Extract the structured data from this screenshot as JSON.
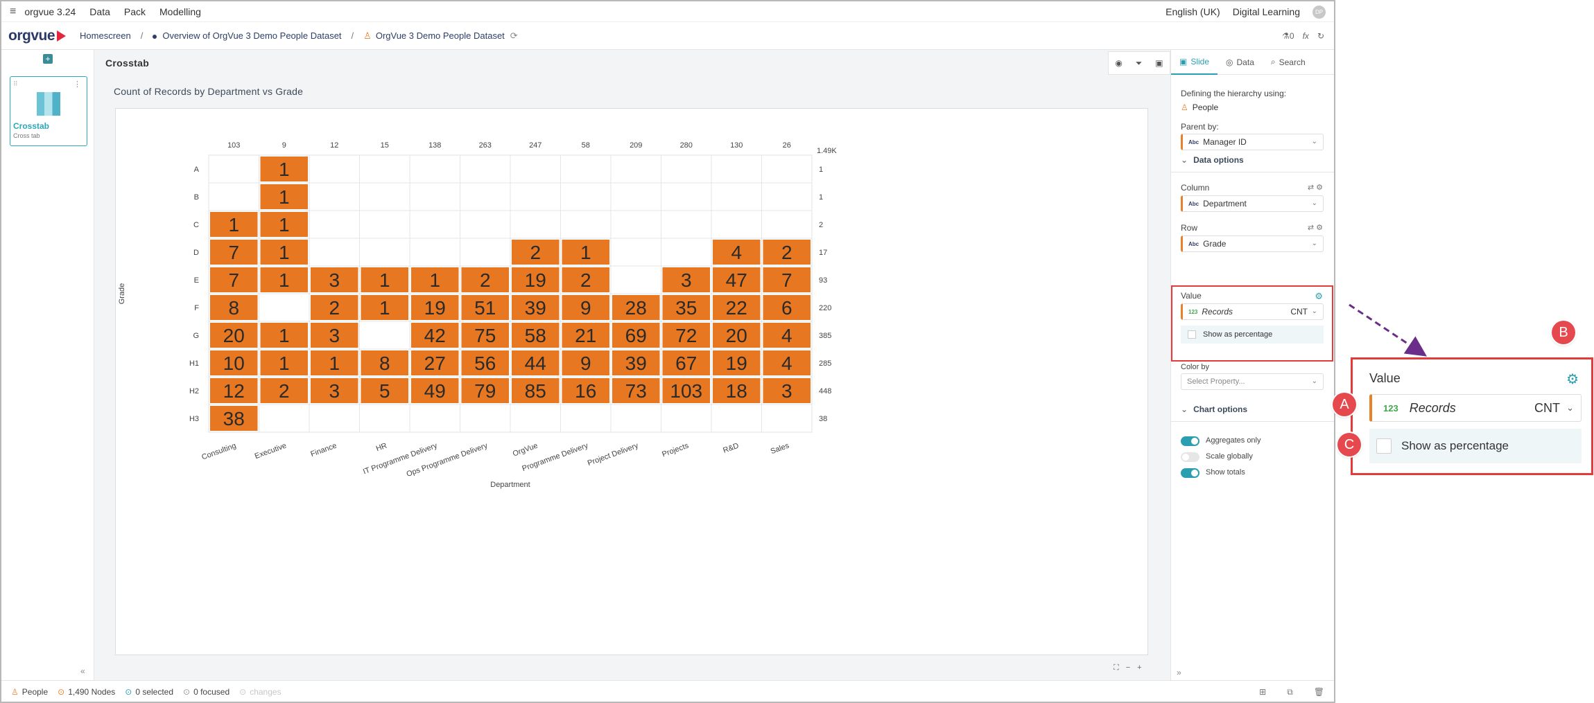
{
  "topbar": {
    "app_version": "orgvue 3.24",
    "menus": [
      "Data",
      "Pack",
      "Modelling"
    ],
    "language": "English (UK)",
    "workspace": "Digital Learning",
    "avatar_initials": "DP"
  },
  "header": {
    "logo": "orgvue",
    "breadcrumbs": [
      "Homescreen",
      "Overview of OrgVue 3 Demo People Dataset",
      "OrgVue 3 Demo People Dataset"
    ],
    "counter": "0"
  },
  "slides": {
    "thumb_title": "Crosstab",
    "thumb_subtitle": "Cross tab"
  },
  "main": {
    "slide_title": "Crosstab",
    "chart_title": "Count of Records by Department vs Grade"
  },
  "chart_data": {
    "type": "heatmap",
    "title": "Count of Records by Department vs Grade",
    "xlabel": "Department",
    "ylabel": "Grade",
    "columns": [
      "Consulting",
      "Executive",
      "Finance",
      "HR",
      "IT Programme Delivery",
      "Ops Programme Delivery",
      "OrgVue",
      "Programme Delivery",
      "Project Delivery",
      "Projects",
      "R&D",
      "Sales"
    ],
    "column_totals": [
      "103",
      "9",
      "12",
      "15",
      "138",
      "263",
      "247",
      "58",
      "209",
      "280",
      "130",
      "26"
    ],
    "rows": [
      "A",
      "B",
      "C",
      "D",
      "E",
      "F",
      "G",
      "H1",
      "H2",
      "H3"
    ],
    "row_totals": [
      "1",
      "1",
      "2",
      "17",
      "93",
      "220",
      "385",
      "285",
      "448",
      "38"
    ],
    "grand_total": "1.49K",
    "values": [
      [
        null,
        1,
        null,
        null,
        null,
        null,
        null,
        null,
        null,
        null,
        null,
        null
      ],
      [
        null,
        1,
        null,
        null,
        null,
        null,
        null,
        null,
        null,
        null,
        null,
        null
      ],
      [
        1,
        1,
        null,
        null,
        null,
        null,
        null,
        null,
        null,
        null,
        null,
        null
      ],
      [
        7,
        1,
        null,
        null,
        null,
        null,
        2,
        1,
        null,
        null,
        4,
        2
      ],
      [
        7,
        1,
        3,
        1,
        1,
        2,
        19,
        2,
        null,
        3,
        47,
        7
      ],
      [
        8,
        null,
        2,
        1,
        19,
        51,
        39,
        9,
        28,
        35,
        22,
        6
      ],
      [
        20,
        1,
        3,
        null,
        42,
        75,
        58,
        21,
        69,
        72,
        20,
        4
      ],
      [
        10,
        1,
        1,
        8,
        27,
        56,
        44,
        9,
        39,
        67,
        19,
        4
      ],
      [
        12,
        2,
        3,
        5,
        49,
        79,
        85,
        16,
        73,
        103,
        18,
        3
      ],
      [
        38,
        null,
        null,
        null,
        null,
        null,
        null,
        null,
        null,
        null,
        null,
        null
      ]
    ],
    "cell_color": "#e87722"
  },
  "panel": {
    "tabs": [
      "Slide",
      "Data",
      "Search"
    ],
    "hierarchy_label": "Defining the hierarchy using:",
    "hierarchy_value": "People",
    "parent_label": "Parent by:",
    "parent_value": "Manager ID",
    "data_options": "Data options",
    "column_label": "Column",
    "column_value": "Department",
    "row_label": "Row",
    "row_value": "Grade",
    "value_label": "Value",
    "value_prop": "Records",
    "value_agg": "CNT",
    "show_pct": "Show as percentage",
    "colorby_label": "Color by",
    "colorby_placeholder": "Select Property...",
    "chart_options": "Chart options",
    "toggles": [
      {
        "label": "Aggregates only",
        "on": true
      },
      {
        "label": "Scale globally",
        "on": false
      },
      {
        "label": "Show totals",
        "on": true
      }
    ]
  },
  "footer": {
    "dataset": "People",
    "nodes": "1,490 Nodes",
    "selected": "0 selected",
    "focused": "0 focused",
    "changes": "changes"
  },
  "callout": {
    "title": "Value",
    "prop": "Records",
    "agg": "CNT",
    "num_tag": "123",
    "show_pct": "Show as percentage",
    "badges": [
      "A",
      "B",
      "C"
    ]
  }
}
